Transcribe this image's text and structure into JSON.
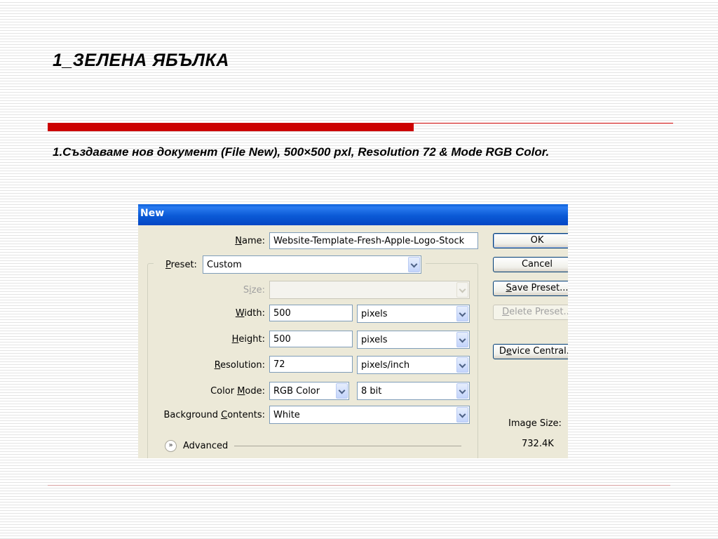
{
  "slide": {
    "title": "1_ЗЕЛЕНА ЯБЪЛКА",
    "body": "1.Създаваме нов документ (File New), 500×500 pxl, Resolution 72 & Mode RGB Color.",
    "accent_color": "#cc0000"
  },
  "dialog": {
    "title": "New",
    "name_label_u": "N",
    "name_label_rest": "ame:",
    "name_value": "Website-Template-Fresh-Apple-Logo-Stock",
    "preset_label_u": "P",
    "preset_label_rest": "reset:",
    "preset_value": "Custom",
    "size_label_pre": "S",
    "size_label_u": "i",
    "size_label_rest": "ze:",
    "size_value": "",
    "width_label_u": "W",
    "width_label_rest": "idth:",
    "width_value": "500",
    "width_unit": "pixels",
    "height_label_u": "H",
    "height_label_rest": "eight:",
    "height_value": "500",
    "height_unit": "pixels",
    "resolution_label_u": "R",
    "resolution_label_rest": "esolution:",
    "resolution_value": "72",
    "resolution_unit": "pixels/inch",
    "color_mode_label_pre": "Color ",
    "color_mode_label_u": "M",
    "color_mode_label_rest": "ode:",
    "color_mode_value": "RGB Color",
    "bit_depth_value": "8 bit",
    "background_label_pre": "Background ",
    "background_label_u": "C",
    "background_label_rest": "ontents:",
    "background_value": "White",
    "advanced_label": "Advanced",
    "buttons": {
      "ok": "OK",
      "cancel": "Cancel",
      "save_preset_u": "S",
      "save_preset_rest": "ave Preset...",
      "delete_preset_u": "D",
      "delete_preset_rest": "elete Preset...",
      "device_central_pre": "D",
      "device_central_u": "e",
      "device_central_rest": "vice Central..."
    },
    "image_size_label": "Image Size:",
    "image_size_value": "732.4K"
  }
}
